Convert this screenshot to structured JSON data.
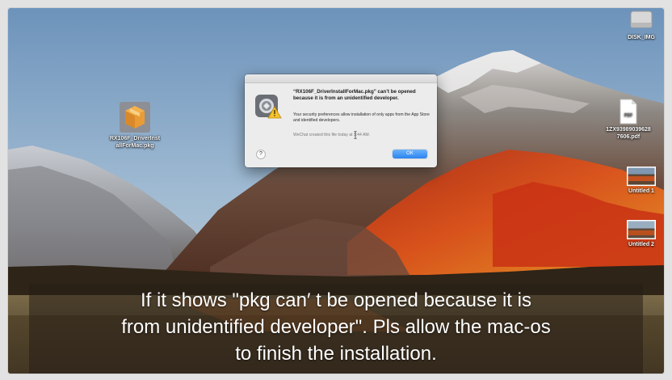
{
  "desktop": {
    "icons": [
      {
        "label": "RX106F_DriverInst\nallForMac.pkg",
        "icon": "package-icon"
      },
      {
        "label": "DISK_IMG",
        "icon": "disk-image-icon"
      },
      {
        "label": "1ZX93989039628\n7606.pdf",
        "icon": "pdf-icon",
        "badge": "PDF"
      },
      {
        "label": "Untitled 1",
        "icon": "screenshot-thumbnail-icon"
      },
      {
        "label": "Untitled 2",
        "icon": "screenshot-thumbnail-icon"
      }
    ]
  },
  "dialog": {
    "title": "“RX106F_DriverInstallForMac.pkg” can’t be opened because it is from an unidentified developer.",
    "message": "Your security preferences allow installation of only apps from the App Store and identified developers.",
    "source": "WeChat created this file today at 1:44 AM.",
    "help_label": "?",
    "ok_label": "OK",
    "icon": "gatekeeper-warning-icon"
  },
  "subtitle": {
    "lines": [
      "If it shows \"pkg can′  t be opened because it is",
      "from unidentified developer\". Pls allow the mac-os",
      "to finish the installation."
    ]
  },
  "colors": {
    "ok_button": "#2a84f0",
    "dialog_bg": "#ececec",
    "subtitle_bg": "#261e16"
  }
}
